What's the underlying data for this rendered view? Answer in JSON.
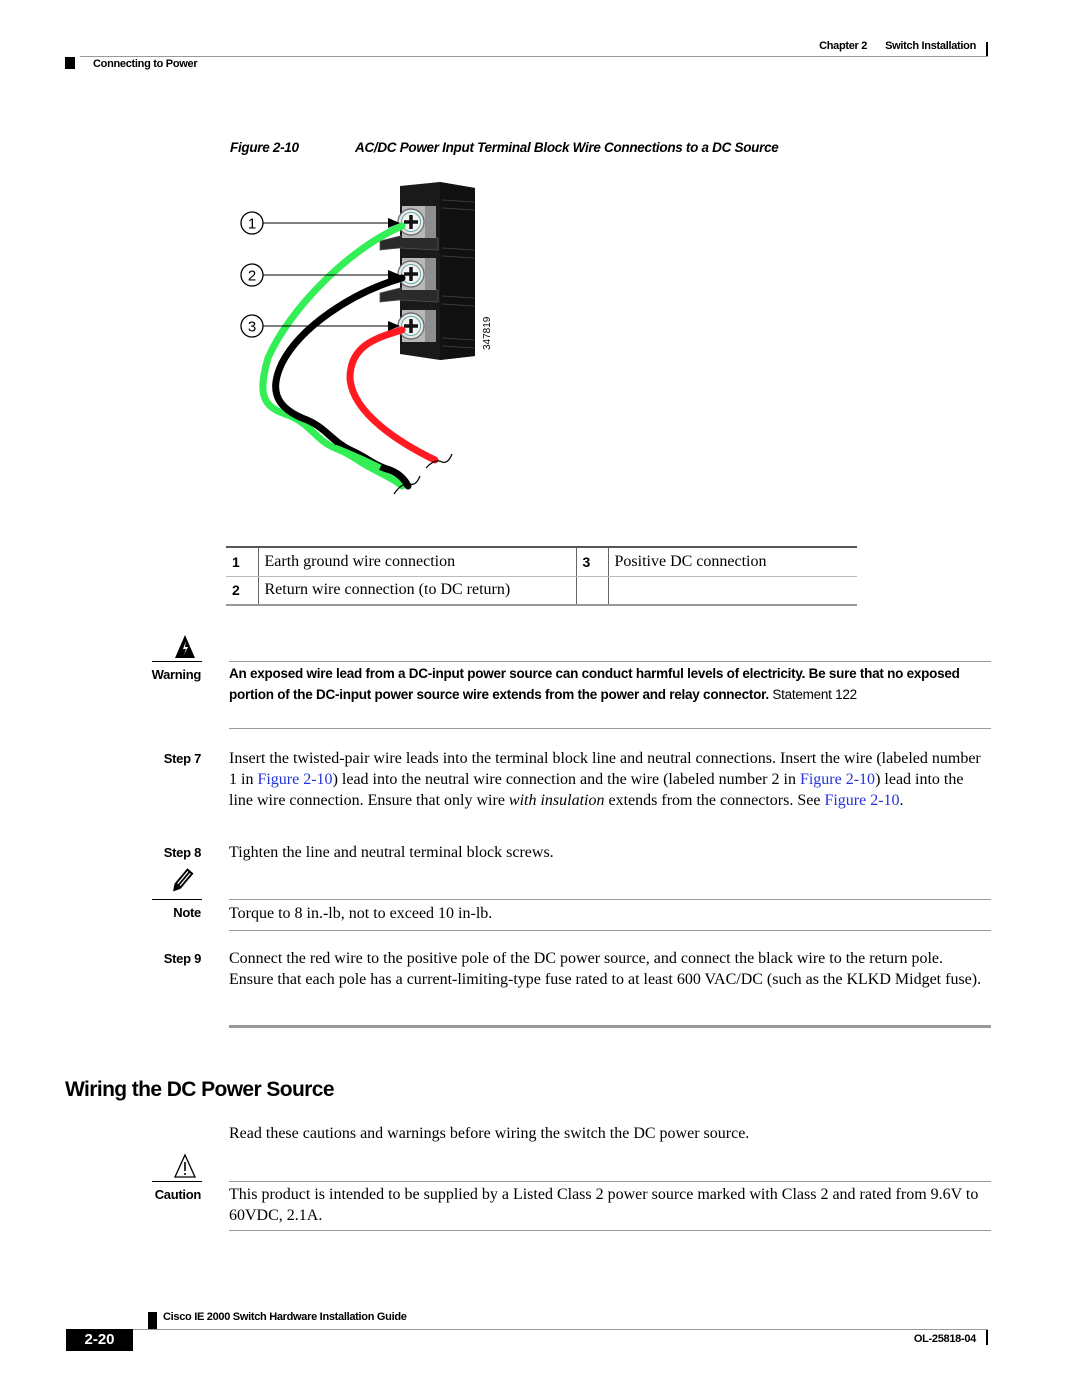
{
  "header": {
    "chapter_label": "Chapter 2",
    "chapter_title": "Switch Installation",
    "section": "Connecting to Power"
  },
  "figure": {
    "label": "Figure 2-10",
    "title": "AC/DC Power Input Terminal Block Wire Connections to a DC Source",
    "callouts": [
      "1",
      "2",
      "3"
    ],
    "art_id": "347819",
    "wire_colors": {
      "ground": "#33ee55",
      "return": "#000000",
      "positive": "#ff1a22"
    }
  },
  "legend": {
    "rows": [
      {
        "num_a": "1",
        "text_a": "Earth ground wire connection",
        "num_b": "3",
        "text_b": "Positive DC connection"
      },
      {
        "num_a": "2",
        "text_a": "Return wire connection (to DC return)",
        "num_b": "",
        "text_b": ""
      }
    ]
  },
  "warning": {
    "label": "Warning",
    "text": "An exposed wire lead from a DC-input power source can conduct harmful levels of electricity. Be sure that no exposed portion of the DC-input power source wire extends from the power and relay connector.",
    "statement": "Statement 122"
  },
  "steps": {
    "step7": {
      "label": "Step 7",
      "t1": "Insert the twisted-pair wire leads into the terminal block line and neutral connections. Insert the wire (labeled number 1 in ",
      "link1": "Figure 2-10",
      "t2": ") lead into the neutral wire connection and the wire (labeled number 2 in ",
      "link2": "Figure 2-10",
      "t3": ") lead into the line wire connection. Ensure that only wire ",
      "em": "with insulation",
      "t4": " extends from the connectors. See ",
      "link3": "Figure 2-10",
      "t5": "."
    },
    "step8": {
      "label": "Step 8",
      "text": "Tighten the line and neutral terminal block screws."
    },
    "note": {
      "label": "Note",
      "text": "Torque to 8 in.-lb, not to exceed 10 in-lb."
    },
    "step9": {
      "label": "Step 9",
      "text": "Connect the red wire to the positive pole of the DC power source, and connect the black wire to the return pole. Ensure that each pole has a current-limiting-type fuse rated to at least 600 VAC/DC (such as the KLKD Midget fuse)."
    }
  },
  "section": {
    "title": "Wiring the DC Power Source",
    "intro": "Read these cautions and warnings before wiring the switch the DC power source."
  },
  "caution": {
    "label": "Caution",
    "text": "This product is intended to be supplied by a Listed Class 2 power source marked with Class 2 and rated from 9.6V to 60VDC, 2.1A."
  },
  "footer": {
    "guide_title": "Cisco IE 2000 Switch Hardware Installation Guide",
    "page_number": "2-20",
    "doc_number": "OL-25818-04"
  },
  "colors": {
    "link": "#2233dd",
    "rule": "#999999"
  }
}
